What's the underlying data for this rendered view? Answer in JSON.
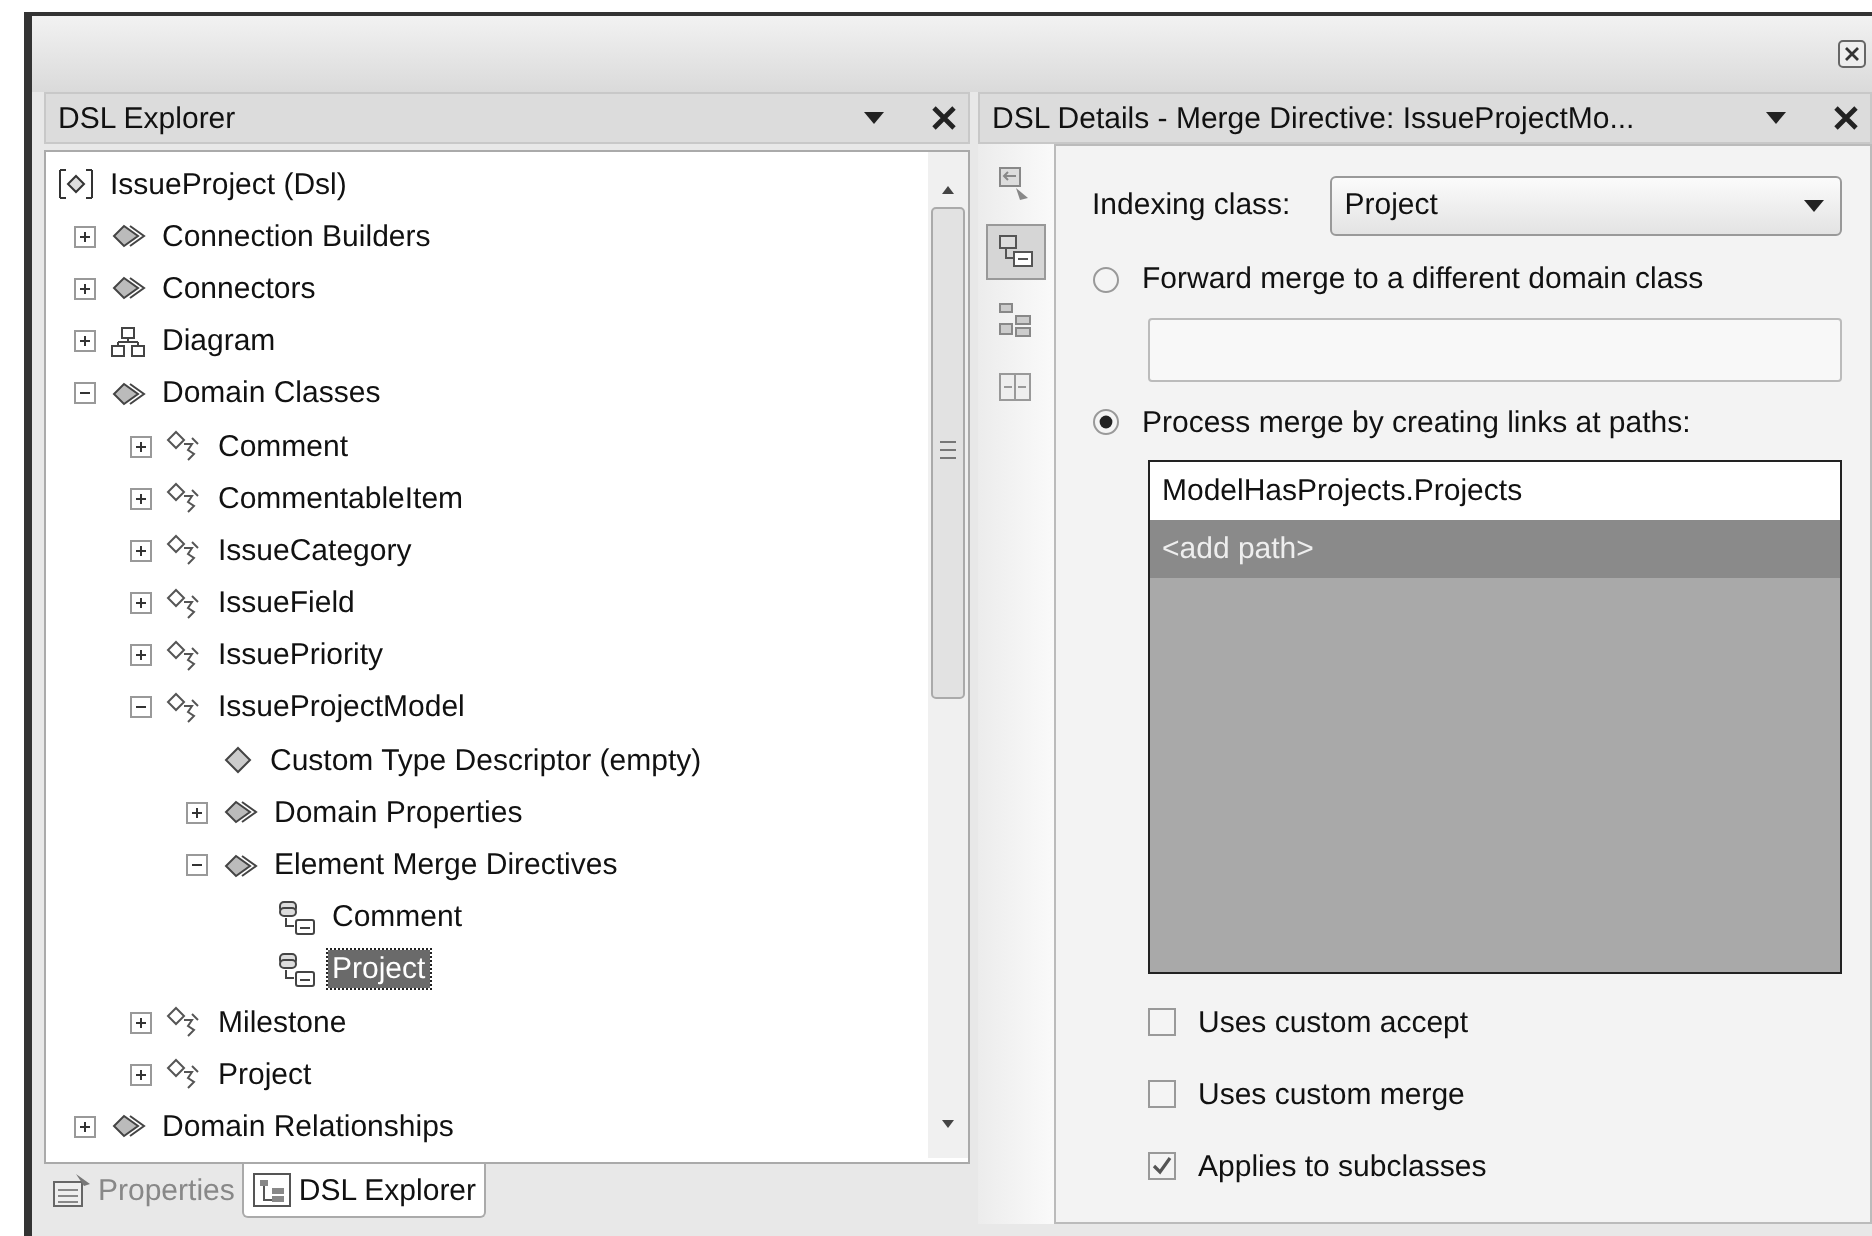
{
  "explorer": {
    "title": "DSL Explorer",
    "tree": [
      {
        "label": "IssueProject (Dsl)",
        "kind": "root",
        "selected": false,
        "children": [
          {
            "label": "Connection Builders",
            "kind": "folder",
            "expanded": false,
            "selected": false
          },
          {
            "label": "Connectors",
            "kind": "folder",
            "expanded": false,
            "selected": false
          },
          {
            "label": "Diagram",
            "kind": "diagram",
            "expanded": false,
            "selected": false
          },
          {
            "label": "Domain Classes",
            "kind": "folder",
            "expanded": true,
            "selected": false,
            "children": [
              {
                "label": "Comment",
                "kind": "class",
                "expanded": false,
                "selected": false
              },
              {
                "label": "CommentableItem",
                "kind": "class",
                "expanded": false,
                "selected": false
              },
              {
                "label": "IssueCategory",
                "kind": "class",
                "expanded": false,
                "selected": false
              },
              {
                "label": "IssueField",
                "kind": "class",
                "expanded": false,
                "selected": false
              },
              {
                "label": "IssuePriority",
                "kind": "class",
                "expanded": false,
                "selected": false
              },
              {
                "label": "IssueProjectModel",
                "kind": "class",
                "expanded": true,
                "selected": false,
                "children": [
                  {
                    "label": "Custom Type Descriptor (empty)",
                    "kind": "property",
                    "selected": false
                  },
                  {
                    "label": "Domain Properties",
                    "kind": "folder",
                    "expanded": false,
                    "selected": false
                  },
                  {
                    "label": "Element Merge Directives",
                    "kind": "folder",
                    "expanded": true,
                    "selected": false,
                    "children": [
                      {
                        "label": "Comment",
                        "kind": "directive",
                        "selected": false
                      },
                      {
                        "label": "Project",
                        "kind": "directive",
                        "selected": true
                      }
                    ]
                  }
                ]
              },
              {
                "label": "Milestone",
                "kind": "class",
                "expanded": false,
                "selected": false
              },
              {
                "label": "Project",
                "kind": "class",
                "expanded": false,
                "selected": false
              }
            ]
          },
          {
            "label": "Domain Relationships",
            "kind": "folder",
            "expanded": false,
            "selected": false
          }
        ]
      }
    ]
  },
  "explorer_tabs": [
    {
      "label": "Properties",
      "kind": "properties",
      "selected": false
    },
    {
      "label": "DSL Explorer",
      "kind": "explorer",
      "selected": true
    }
  ],
  "details": {
    "title": "DSL Details - Merge Directive: IssueProjectMo...",
    "toolbar": [
      {
        "kind": "class",
        "selected": false
      },
      {
        "kind": "directive",
        "selected": true
      },
      {
        "kind": "tree",
        "selected": false
      },
      {
        "kind": "swap",
        "selected": false
      }
    ],
    "indexing_label": "Indexing class:",
    "indexing_value": "Project",
    "options": [
      {
        "label": "Forward merge to a different domain class",
        "selected": false
      },
      {
        "label": "Process merge by creating links at paths:",
        "selected": true
      }
    ],
    "paths": [
      {
        "label": "ModelHasProjects.Projects",
        "selected": false
      },
      {
        "label": "<add path>",
        "selected": true
      }
    ],
    "checkboxes": [
      {
        "label": "Uses custom accept",
        "checked": false
      },
      {
        "label": "Uses custom merge",
        "checked": false
      },
      {
        "label": "Applies to subclasses",
        "checked": true
      }
    ]
  }
}
